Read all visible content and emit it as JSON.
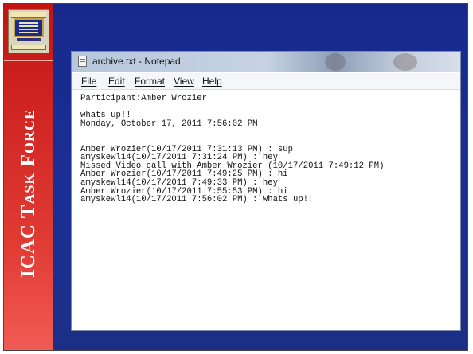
{
  "sidebar": {
    "title": "ICAC Task Force"
  },
  "notepad": {
    "title": "archive.txt - Notepad",
    "menu": [
      "File",
      "Edit",
      "Format",
      "View",
      "Help"
    ],
    "lines": [
      "Participant:Amber Wrozier",
      "",
      "whats up!!",
      "Monday, October 17, 2011 7:56:02 PM",
      "",
      "",
      "Amber Wrozier(10/17/2011 7:31:13 PM) : sup",
      "amyskewl14(10/17/2011 7:31:24 PM) : hey",
      "Missed Video call with Amber Wrozier (10/17/2011 7:49:12 PM)",
      "Amber Wrozier(10/17/2011 7:49:25 PM) : hi",
      "amyskewl14(10/17/2011 7:49:33 PM) : hey",
      "Amber Wrozier(10/17/2011 7:55:53 PM) : hi",
      "amyskewl14(10/17/2011 7:56:02 PM) : whats up!!"
    ]
  }
}
